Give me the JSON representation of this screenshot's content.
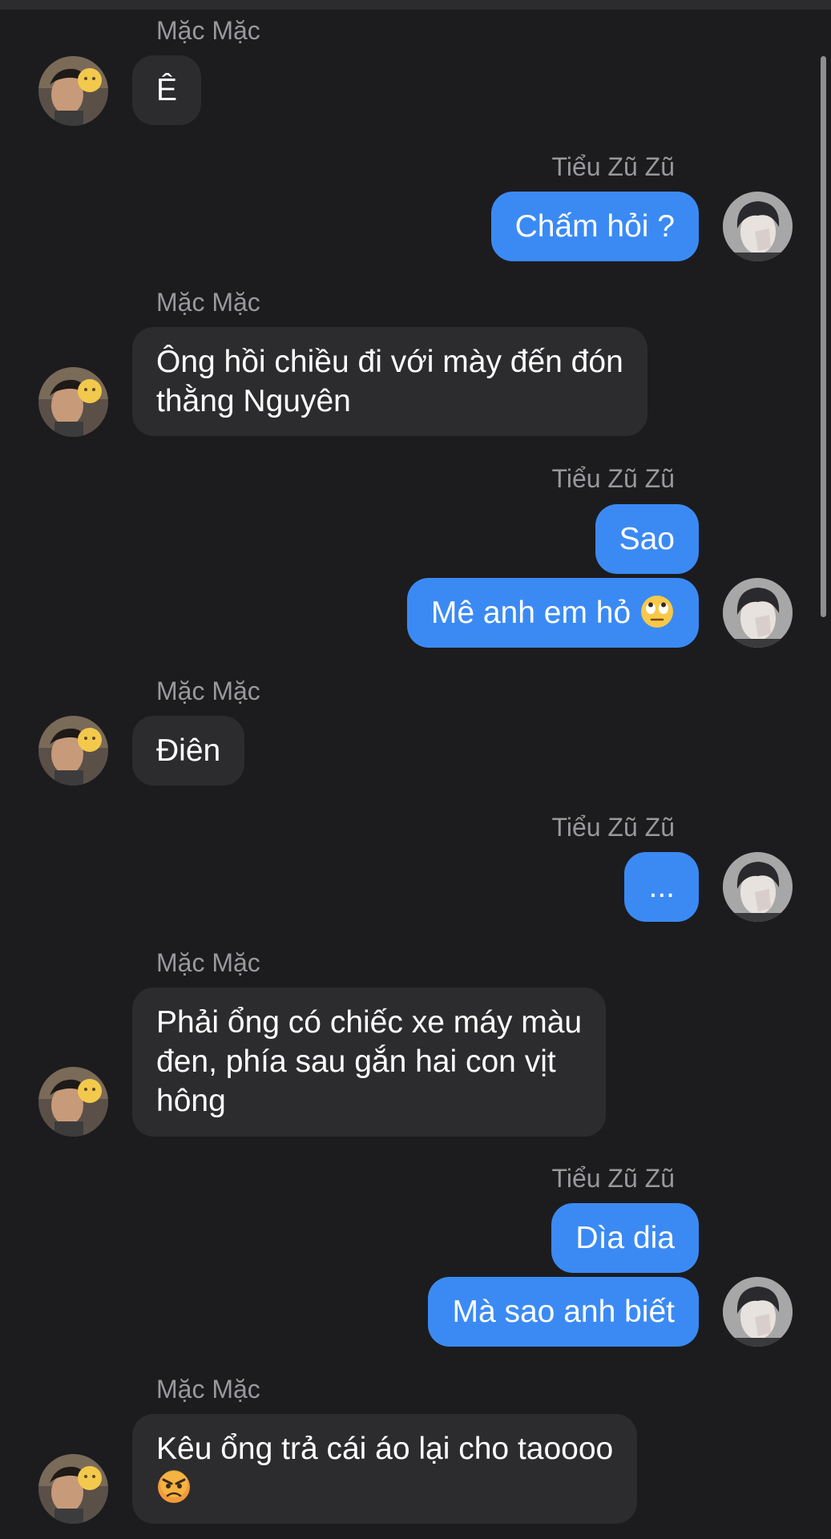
{
  "participants": {
    "left_name": "Mặc Mặc",
    "right_name": "Tiểu Zũ Zũ"
  },
  "messages": {
    "m1": "Ê",
    "m2": "Chấm hỏi ?",
    "m3_line1": "Ông hồi chiều đi với mày đến đón",
    "m3_line2": "thằng Nguyên",
    "m4": "Sao",
    "m5": "Mê anh em hỏ",
    "m6": "Điên",
    "m7": "...",
    "m8_line1": "Phải ổng có chiếc xe máy màu",
    "m8_line2": "đen, phía sau gắn hai con vịt",
    "m8_line3": "hông",
    "m9": "Dìa dia",
    "m10": "Mà sao anh biết",
    "m11_line1": "Kêu ổng trả cái áo lại cho taoooo"
  },
  "emoji": {
    "m5": "face-with-rolling-eyes-icon",
    "m11": "angry-face-icon"
  },
  "colors": {
    "background": "#1c1c1e",
    "incoming_bubble": "#2c2c2e",
    "outgoing_bubble": "#3b8af4",
    "sender_name": "#98989d"
  }
}
